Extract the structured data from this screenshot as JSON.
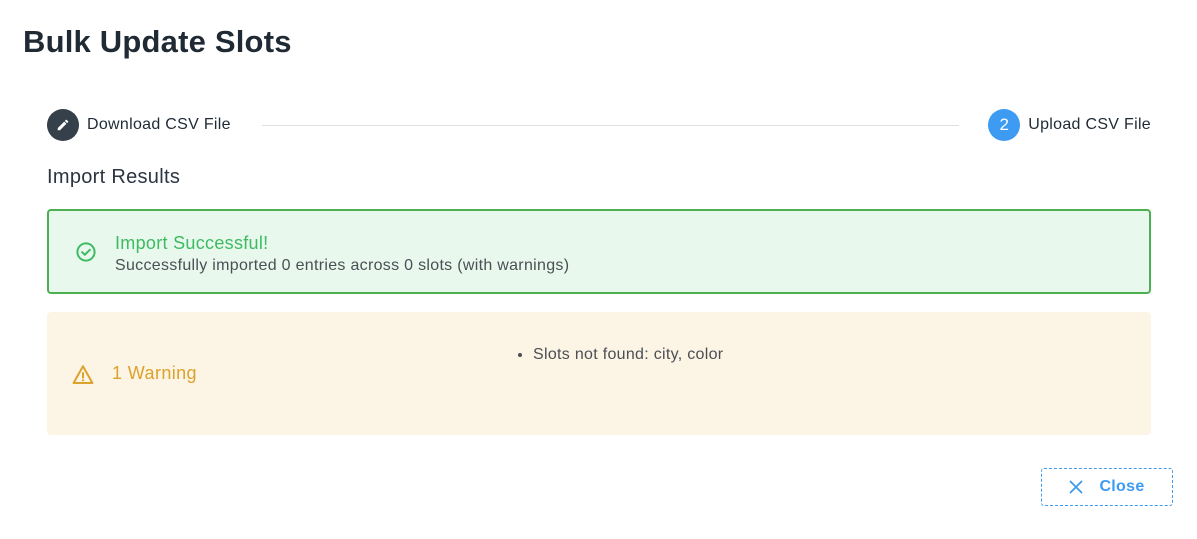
{
  "dialog": {
    "title": "Bulk Update Slots"
  },
  "stepper": {
    "steps": [
      {
        "label": "Download CSV File",
        "state": "completed",
        "icon": "pencil-icon"
      },
      {
        "label": "Upload CSV File",
        "state": "active",
        "number": "2"
      }
    ]
  },
  "results": {
    "section_title": "Import Results",
    "success": {
      "icon": "check-circle-icon",
      "title": "Import Successful!",
      "message": "Successfully imported 0 entries across 0 slots (with warnings)"
    },
    "warning": {
      "icon": "warning-triangle-icon",
      "title": "1 Warning",
      "items": [
        "Slots not found: city, color"
      ]
    }
  },
  "actions": {
    "close_label": "Close",
    "close_icon": "close-icon"
  },
  "colors": {
    "primary": "#3d9bf2",
    "success": "#3dbb62",
    "success_bg": "#e8f8ed",
    "warning": "#dba22c",
    "warning_bg": "#fcf4e4",
    "step_done": "#35404b"
  }
}
